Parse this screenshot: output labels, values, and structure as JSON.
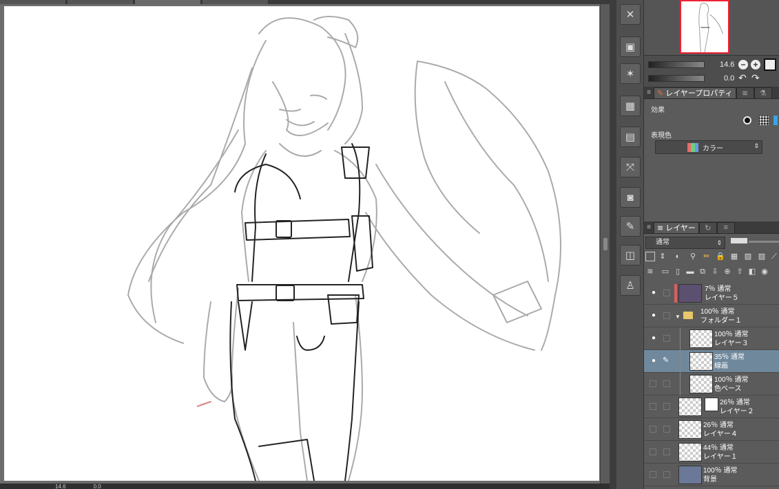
{
  "navigator": {
    "zoom": "14.6",
    "rotation": "0.0"
  },
  "layer_property": {
    "tab_label": "レイヤープロパティ",
    "effect_label": "効果",
    "expression_color_label": "表現色",
    "expression_color_value": "カラー",
    "swatch_colors": [
      "#e86a6a",
      "#6ad07a",
      "#6a9ae8"
    ]
  },
  "layer_panel": {
    "tab_label": "レイヤー",
    "blend_mode": "通常",
    "layers": [
      {
        "name": "レイヤー５",
        "info": "7％ 通常",
        "visible": true,
        "thumb_color": "#5c5070",
        "color_tag": true
      },
      {
        "name": "フォルダー１",
        "info": "100％ 通常",
        "visible": true,
        "folder": true
      },
      {
        "name": "レイヤー３",
        "info": "100％ 通常",
        "visible": true
      },
      {
        "name": "線画",
        "info": "35％ 通常",
        "visible": true,
        "selected": true
      },
      {
        "name": "色ベース",
        "info": "100％ 通常",
        "visible": false
      },
      {
        "name": "レイヤー２",
        "info": "26％ 通常",
        "visible": false,
        "mask": true
      },
      {
        "name": "レイヤー４",
        "info": "26％ 通常",
        "visible": false
      },
      {
        "name": "レイヤー１",
        "info": "44％ 通常",
        "visible": false
      },
      {
        "name": "背景",
        "info": "100％ 通常",
        "visible": false,
        "thumb_color": "#6b7898"
      }
    ]
  },
  "statusbar": {
    "zoom": "14.6",
    "rotation": "0.0"
  }
}
